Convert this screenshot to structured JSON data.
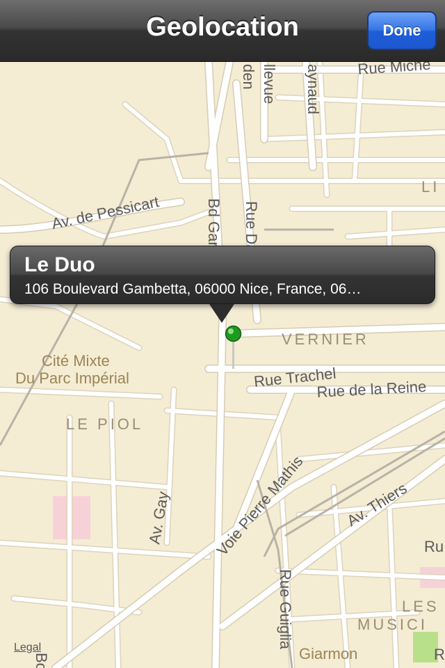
{
  "navbar": {
    "title": "Geolocation",
    "done_label": "Done"
  },
  "map": {
    "streets": {
      "rue_michel": "Rue Miche",
      "bellevue": "llevue",
      "garden": "den",
      "raynaud": "aynaud",
      "li": "LI",
      "pessicart": "Av. de Pessicart",
      "gambetta": "Bd Gambetta",
      "dabray": "Rue Dabray",
      "trachel": "Rue Trachel",
      "reine": "Rue de la Reine",
      "gay": "Av. Gay",
      "pierre_mathis": "Voie Pierre Mathis",
      "thiers": "Av. Thiers",
      "guiglia": "Rue Guiglia",
      "ru": "Ru",
      "r": "R",
      "bo": "Bo"
    },
    "districts": {
      "vernier": "VERNIER",
      "le_piol": "LE PIOL",
      "les_musiciens_1": "LES",
      "les_musiciens_2": "MUSICI"
    },
    "poi": {
      "cite_line1": "Cité Mixte",
      "cite_line2": "Du Parc Impérial",
      "giarmon": "Giarmon"
    },
    "legal_label": "Legal",
    "colors": {
      "land": "#f5ecd4",
      "road": "#ffffff",
      "road_casing": "#d9cfb8",
      "rail": "#b8b2a6",
      "park": "#b8e08a",
      "pink_block": "#f6d2d8",
      "pin": "#1f9a1f"
    }
  },
  "callout": {
    "title": "Le Duo",
    "subtitle": "106 Boulevard Gambetta, 06000 Nice, France, 06…"
  }
}
